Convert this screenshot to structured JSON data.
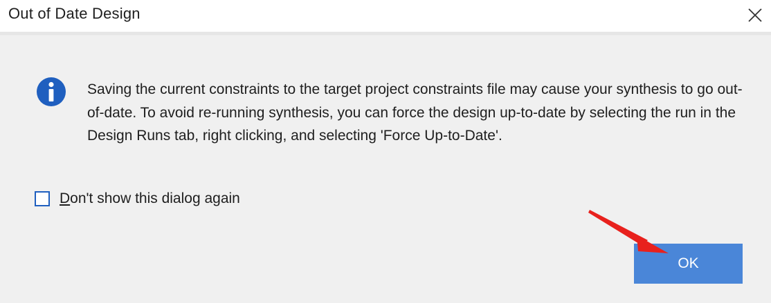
{
  "window": {
    "title": "Out of Date Design",
    "close_glyph": "×"
  },
  "message": {
    "icon": "info-icon",
    "icon_color": "#1f5fbf",
    "text": "Saving the current constraints to the target project constraints file may cause your synthesis to go out-of-date. To avoid re-running synthesis, you can force the design up-to-date by selecting the run in the Design Runs tab, right clicking, and selecting 'Force Up-to-Date'."
  },
  "checkbox": {
    "mnemonic": "D",
    "label_rest": "on't show this dialog again",
    "checked": false
  },
  "buttons": {
    "ok_label": "OK",
    "ok_color": "#4a86d8"
  },
  "annotation": {
    "arrow_color": "#e8211d",
    "points_to": "ok-button"
  }
}
